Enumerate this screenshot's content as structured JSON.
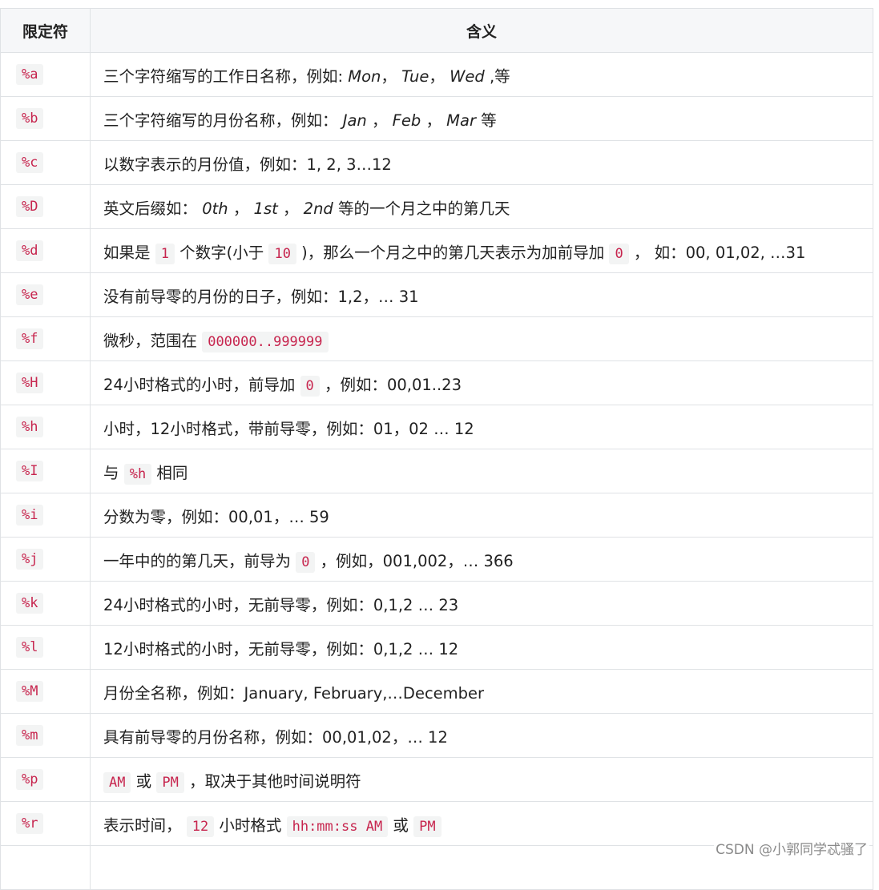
{
  "table": {
    "headers": {
      "spec": "限定符",
      "meaning": "含义"
    },
    "rows": [
      {
        "spec": "%a",
        "parts": [
          {
            "t": "text",
            "v": "三个字符缩写的工作日名称，例如: "
          },
          {
            "t": "em",
            "v": "Mon"
          },
          {
            "t": "text",
            "v": "， "
          },
          {
            "t": "em",
            "v": "Tue"
          },
          {
            "t": "text",
            "v": "， "
          },
          {
            "t": "em",
            "v": "Wed"
          },
          {
            "t": "text",
            "v": " ,等"
          }
        ]
      },
      {
        "spec": "%b",
        "parts": [
          {
            "t": "text",
            "v": "三个字符缩写的月份名称，例如： "
          },
          {
            "t": "em",
            "v": "Jan"
          },
          {
            "t": "text",
            "v": " ， "
          },
          {
            "t": "em",
            "v": "Feb"
          },
          {
            "t": "text",
            "v": " ， "
          },
          {
            "t": "em",
            "v": "Mar"
          },
          {
            "t": "text",
            "v": " 等"
          }
        ]
      },
      {
        "spec": "%c",
        "parts": [
          {
            "t": "text",
            "v": "以数字表示的月份值，例如：1, 2, 3…12"
          }
        ]
      },
      {
        "spec": "%D",
        "parts": [
          {
            "t": "text",
            "v": "英文后缀如： "
          },
          {
            "t": "em",
            "v": "0th"
          },
          {
            "t": "text",
            "v": " ， "
          },
          {
            "t": "em",
            "v": "1st"
          },
          {
            "t": "text",
            "v": " ， "
          },
          {
            "t": "em",
            "v": "2nd"
          },
          {
            "t": "text",
            "v": " 等的一个月之中的第几天"
          }
        ]
      },
      {
        "spec": "%d",
        "parts": [
          {
            "t": "text",
            "v": "如果是 "
          },
          {
            "t": "code",
            "v": "1"
          },
          {
            "t": "text",
            "v": " 个数字(小于 "
          },
          {
            "t": "code",
            "v": "10"
          },
          {
            "t": "text",
            "v": " )，那么一个月之中的第几天表示为加前导加 "
          },
          {
            "t": "code",
            "v": "0"
          },
          {
            "t": "text",
            "v": " ， 如：00, 01,02, …31"
          }
        ]
      },
      {
        "spec": "%e",
        "parts": [
          {
            "t": "text",
            "v": "没有前导零的月份的日子，例如：1,2，… 31"
          }
        ]
      },
      {
        "spec": "%f",
        "parts": [
          {
            "t": "text",
            "v": "微秒，范围在 "
          },
          {
            "t": "code",
            "v": "000000..999999"
          }
        ]
      },
      {
        "spec": "%H",
        "parts": [
          {
            "t": "text",
            "v": "24小时格式的小时，前导加 "
          },
          {
            "t": "code",
            "v": "0"
          },
          {
            "t": "text",
            "v": " ，例如：00,01..23"
          }
        ]
      },
      {
        "spec": "%h",
        "parts": [
          {
            "t": "text",
            "v": "小时，12小时格式，带前导零，例如：01，02 … 12"
          }
        ]
      },
      {
        "spec": "%I",
        "parts": [
          {
            "t": "text",
            "v": "与 "
          },
          {
            "t": "code",
            "v": "%h"
          },
          {
            "t": "text",
            "v": " 相同"
          }
        ]
      },
      {
        "spec": "%i",
        "parts": [
          {
            "t": "text",
            "v": "分数为零，例如：00,01，… 59"
          }
        ]
      },
      {
        "spec": "%j",
        "parts": [
          {
            "t": "text",
            "v": "一年中的的第几天，前导为 "
          },
          {
            "t": "code",
            "v": "0"
          },
          {
            "t": "text",
            "v": " ，例如，001,002，… 366"
          }
        ]
      },
      {
        "spec": "%k",
        "parts": [
          {
            "t": "text",
            "v": "24小时格式的小时，无前导零，例如：0,1,2 … 23"
          }
        ]
      },
      {
        "spec": "%l",
        "parts": [
          {
            "t": "text",
            "v": "12小时格式的小时，无前导零，例如：0,1,2 … 12"
          }
        ]
      },
      {
        "spec": "%M",
        "parts": [
          {
            "t": "text",
            "v": "月份全名称，例如：January, February,…December"
          }
        ]
      },
      {
        "spec": "%m",
        "parts": [
          {
            "t": "text",
            "v": "具有前导零的月份名称，例如：00,01,02，… 12"
          }
        ]
      },
      {
        "spec": "%p",
        "parts": [
          {
            "t": "text",
            "v": " "
          },
          {
            "t": "code",
            "v": "AM"
          },
          {
            "t": "text",
            "v": " 或 "
          },
          {
            "t": "code",
            "v": "PM"
          },
          {
            "t": "text",
            "v": " ，取决于其他时间说明符"
          }
        ]
      },
      {
        "spec": "%r",
        "parts": [
          {
            "t": "text",
            "v": "表示时间， "
          },
          {
            "t": "code",
            "v": "12"
          },
          {
            "t": "text",
            "v": " 小时格式 "
          },
          {
            "t": "code",
            "v": "hh:mm:ss AM"
          },
          {
            "t": "text",
            "v": " 或 "
          },
          {
            "t": "code",
            "v": "PM"
          }
        ]
      }
    ]
  },
  "watermark": "CSDN @小郭同学忒骚了"
}
